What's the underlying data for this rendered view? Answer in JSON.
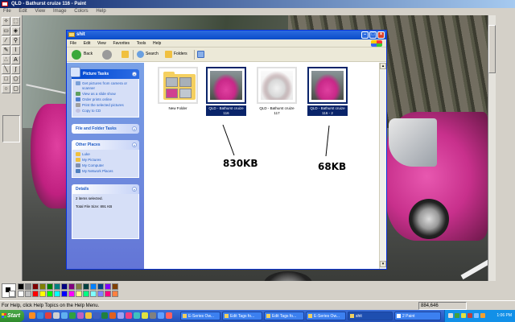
{
  "paint": {
    "title": "QLD - Bathurst cruize 116 - Paint",
    "menu": [
      "File",
      "Edit",
      "View",
      "Image",
      "Colors",
      "Help"
    ],
    "status_text": "For Help, click Help Topics on the Help Menu.",
    "coords": "884,646"
  },
  "palette": {
    "row1": [
      "#000000",
      "#808080",
      "#800000",
      "#808000",
      "#008000",
      "#008080",
      "#000080",
      "#800080",
      "#808040",
      "#004040",
      "#0080ff",
      "#004080",
      "#8000ff",
      "#804000"
    ],
    "row2": [
      "#ffffff",
      "#c0c0c0",
      "#ff0000",
      "#ffff00",
      "#00ff00",
      "#00ffff",
      "#0000ff",
      "#ff00ff",
      "#ffff80",
      "#00ff80",
      "#80ffff",
      "#8080ff",
      "#ff0080",
      "#ff8040"
    ]
  },
  "explorer": {
    "title": "shit",
    "menu": [
      "File",
      "Edit",
      "View",
      "Favorites",
      "Tools",
      "Help"
    ],
    "toolbar": {
      "back": "Back",
      "search": "Search",
      "folders": "Folders"
    },
    "picture_tasks": {
      "title": "Picture Tasks",
      "items": [
        "Get pictures from camera or scanner",
        "View as a slide show",
        "Order prints online",
        "Print the selected pictures",
        "Copy to CD"
      ]
    },
    "file_folder_tasks": {
      "title": "File and Folder Tasks"
    },
    "other_places": {
      "title": "Other Places",
      "items": [
        "Luke",
        "My Pictures",
        "My Computer",
        "My Network Places"
      ]
    },
    "details": {
      "title": "Details",
      "selected": "2 items selected.",
      "size": "Total File Size: 891 KB"
    },
    "files": [
      {
        "name": "New Folder",
        "kind": "folder",
        "selected": false
      },
      {
        "name": "QLD - Bathurst cruize 116",
        "kind": "pink-car",
        "selected": true
      },
      {
        "name": "QLD - Bathurst cruize 117",
        "kind": "white-car",
        "selected": false
      },
      {
        "name": "QLD - Bathurst cruize 116 - 2",
        "kind": "pink-car",
        "selected": true
      }
    ]
  },
  "annotations": [
    "830KB",
    "68KB"
  ],
  "taskbar": {
    "start": "Start",
    "tasks": [
      "E-Series Ow...",
      "Edit Tags fo...",
      "Edit Tags fo...",
      "E-Series Ow...",
      "shit",
      "2 Paint"
    ],
    "clock": "1:06 PM"
  }
}
